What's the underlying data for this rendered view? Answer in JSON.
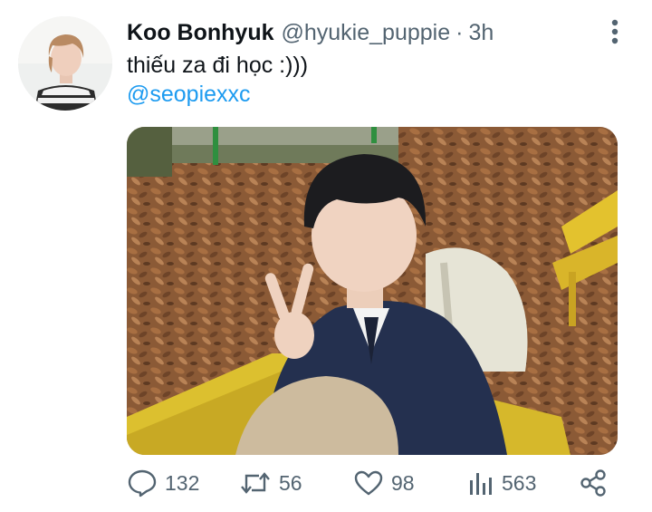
{
  "tweet": {
    "author": {
      "name": "Koo Bonhyuk",
      "handle": "@hyukie_puppie"
    },
    "separator": "·",
    "time": "3h",
    "text": "thiếu za đi học :)))",
    "mention": "@seopiexxc",
    "stats": {
      "replies": "132",
      "retweets": "56",
      "likes": "98",
      "views": "563"
    },
    "icons": {
      "menu": "more-vertical-icon",
      "reply": "comment-icon",
      "retweet": "retweet-icon",
      "like": "heart-icon",
      "views": "bar-chart-icon",
      "share": "share-icon"
    },
    "colors": {
      "text": "#0f1419",
      "secondary": "#536471",
      "link": "#1d9bf0"
    }
  }
}
